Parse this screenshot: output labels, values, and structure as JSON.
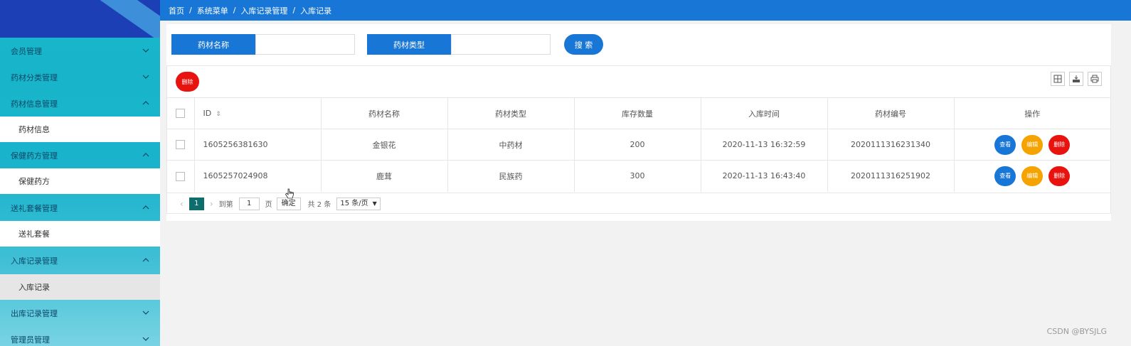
{
  "sidebar": {
    "menus": [
      {
        "label": "会员管理",
        "expanded": false
      },
      {
        "label": "药材分类管理",
        "expanded": false
      },
      {
        "label": "药材信息管理",
        "expanded": true,
        "sub": "药材信息"
      },
      {
        "label": "保健药方管理",
        "expanded": true,
        "sub": "保健药方"
      },
      {
        "label": "送礼套餐管理",
        "expanded": true,
        "sub": "送礼套餐"
      },
      {
        "label": "入库记录管理",
        "expanded": true,
        "sub": "入库记录"
      },
      {
        "label": "出库记录管理",
        "expanded": false
      },
      {
        "label": "管理员管理",
        "expanded": false
      }
    ]
  },
  "breadcrumb": [
    "首页",
    "系统菜单",
    "入库记录管理",
    "入库记录"
  ],
  "search": {
    "name_label": "药材名称",
    "name_value": "",
    "type_label": "药材类型",
    "type_value": "",
    "button": "搜 索"
  },
  "toolbar": {
    "delete_label": "删除",
    "icons": [
      "columns-icon",
      "export-icon",
      "print-icon"
    ]
  },
  "table": {
    "headers": [
      "ID",
      "药材名称",
      "药材类型",
      "库存数量",
      "入库时间",
      "药材编号",
      "操作"
    ],
    "rows": [
      [
        "1605256381630",
        "金银花",
        "中药材",
        "200",
        "2020-11-13 16:32:59",
        "2020111316231340"
      ],
      [
        "1605257024908",
        "鹿茸",
        "民族药",
        "300",
        "2020-11-13 16:43:40",
        "2020111316251902"
      ]
    ],
    "actions": {
      "view": "查看",
      "edit": "编辑",
      "delete": "删除"
    }
  },
  "pager": {
    "current": "1",
    "goto_label": "到第",
    "goto_value": "1",
    "page_unit": "页",
    "confirm": "确定",
    "total": "共 2 条",
    "page_size": "15 条/页"
  },
  "colors": {
    "primary": "#1877d6",
    "warning": "#f5a300",
    "danger": "#e8130f",
    "sidebar": "#17b6c9"
  },
  "watermark": "CSDN @BYSJLG"
}
